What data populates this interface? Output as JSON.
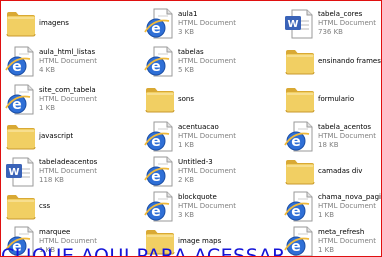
{
  "colors": {
    "frame_border": "#e01010",
    "banner_text": "#1414d8",
    "meta_text": "#808080",
    "folder": "#f1cf63",
    "ie_blue": "#2f6fd6",
    "word_blue": "#3a63b8"
  },
  "files": [
    {
      "name": "imagens",
      "icon": "folder-icon"
    },
    {
      "name": "aula1",
      "type": "HTML Document",
      "size": "3 KB",
      "icon": "ie-document-icon"
    },
    {
      "name": "tabela_cores",
      "type": "HTML Document",
      "size": "736 KB",
      "icon": "word-document-icon"
    },
    {
      "name": "aula_html_listas",
      "type": "HTML Document",
      "size": "4 KB",
      "icon": "ie-document-icon"
    },
    {
      "name": "tabelas",
      "type": "HTML Document",
      "size": "5 KB",
      "icon": "ie-document-icon"
    },
    {
      "name": "ensinando frames",
      "icon": "folder-icon"
    },
    {
      "name": "site_com_tabela",
      "type": "HTML Document",
      "size": "1 KB",
      "icon": "ie-document-icon"
    },
    {
      "name": "sons",
      "icon": "folder-icon"
    },
    {
      "name": "formulario",
      "icon": "folder-icon"
    },
    {
      "name": "javascript",
      "icon": "folder-icon"
    },
    {
      "name": "acentuacao",
      "type": "HTML Document",
      "size": "1 KB",
      "icon": "ie-document-icon"
    },
    {
      "name": "tabela_acentos",
      "type": "HTML Document",
      "size": "18 KB",
      "icon": "ie-document-icon"
    },
    {
      "name": "tabeladeacentos",
      "type": "HTML Document",
      "size": "118 KB",
      "icon": "word-document-icon"
    },
    {
      "name": "Untitled-3",
      "type": "HTML Document",
      "size": "2 KB",
      "icon": "ie-document-icon"
    },
    {
      "name": "camadas div",
      "icon": "folder-icon"
    },
    {
      "name": "css",
      "icon": "folder-icon"
    },
    {
      "name": "blockquote",
      "type": "HTML Document",
      "size": "3 KB",
      "icon": "ie-document-icon"
    },
    {
      "name": "chama_nova_pagina",
      "type": "HTML Document",
      "size": "1 KB",
      "icon": "ie-document-icon"
    },
    {
      "name": "marquee",
      "type": "HTML Document",
      "size": "1 KB",
      "icon": "ie-document-icon"
    },
    {
      "name": "image maps",
      "icon": "folder-icon"
    },
    {
      "name": "meta_refresh",
      "type": "HTML Document",
      "size": "1 KB",
      "icon": "ie-document-icon"
    }
  ],
  "banner": {
    "text": "CLIQUE AQUI PARA ACESSAR"
  }
}
